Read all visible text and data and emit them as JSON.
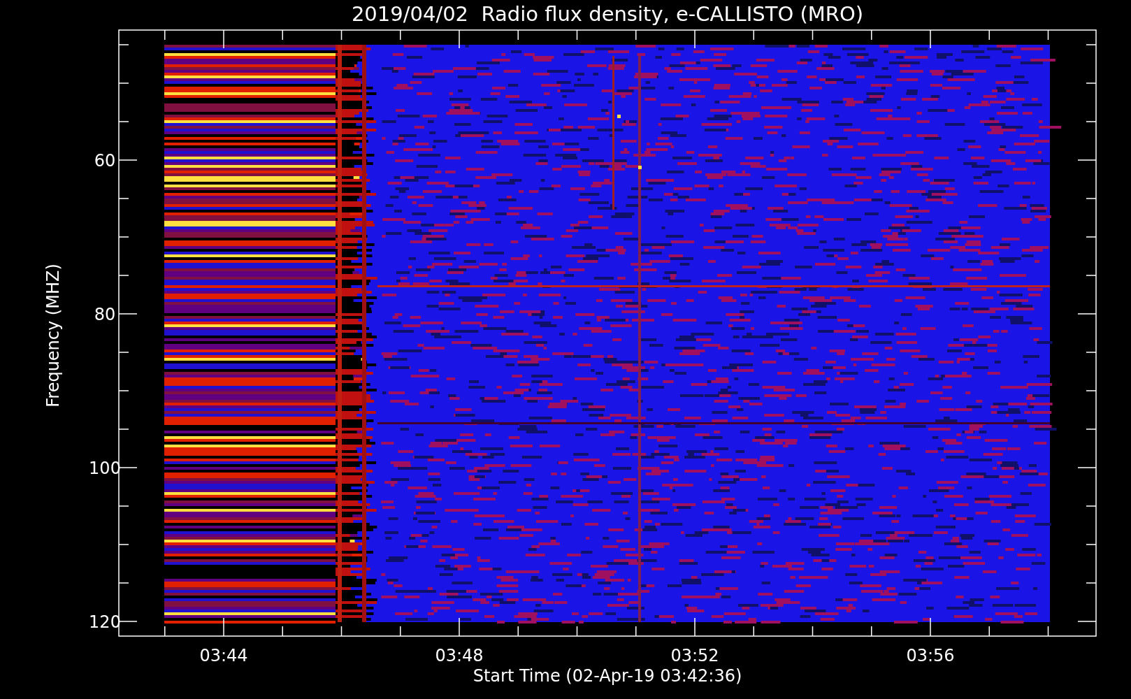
{
  "plot": {
    "title": "2019/04/02  Radio flux density, e-CALLISTO (MRO)",
    "y_axis": {
      "label": "Frequency (MHZ)",
      "ticks": [
        "60",
        "80",
        "100",
        "120"
      ]
    },
    "x_axis": {
      "label": "Start Time (02-Apr-19 03:42:36)",
      "ticks": [
        "03:44",
        "03:48",
        "03:52",
        "03:56"
      ]
    }
  }
}
